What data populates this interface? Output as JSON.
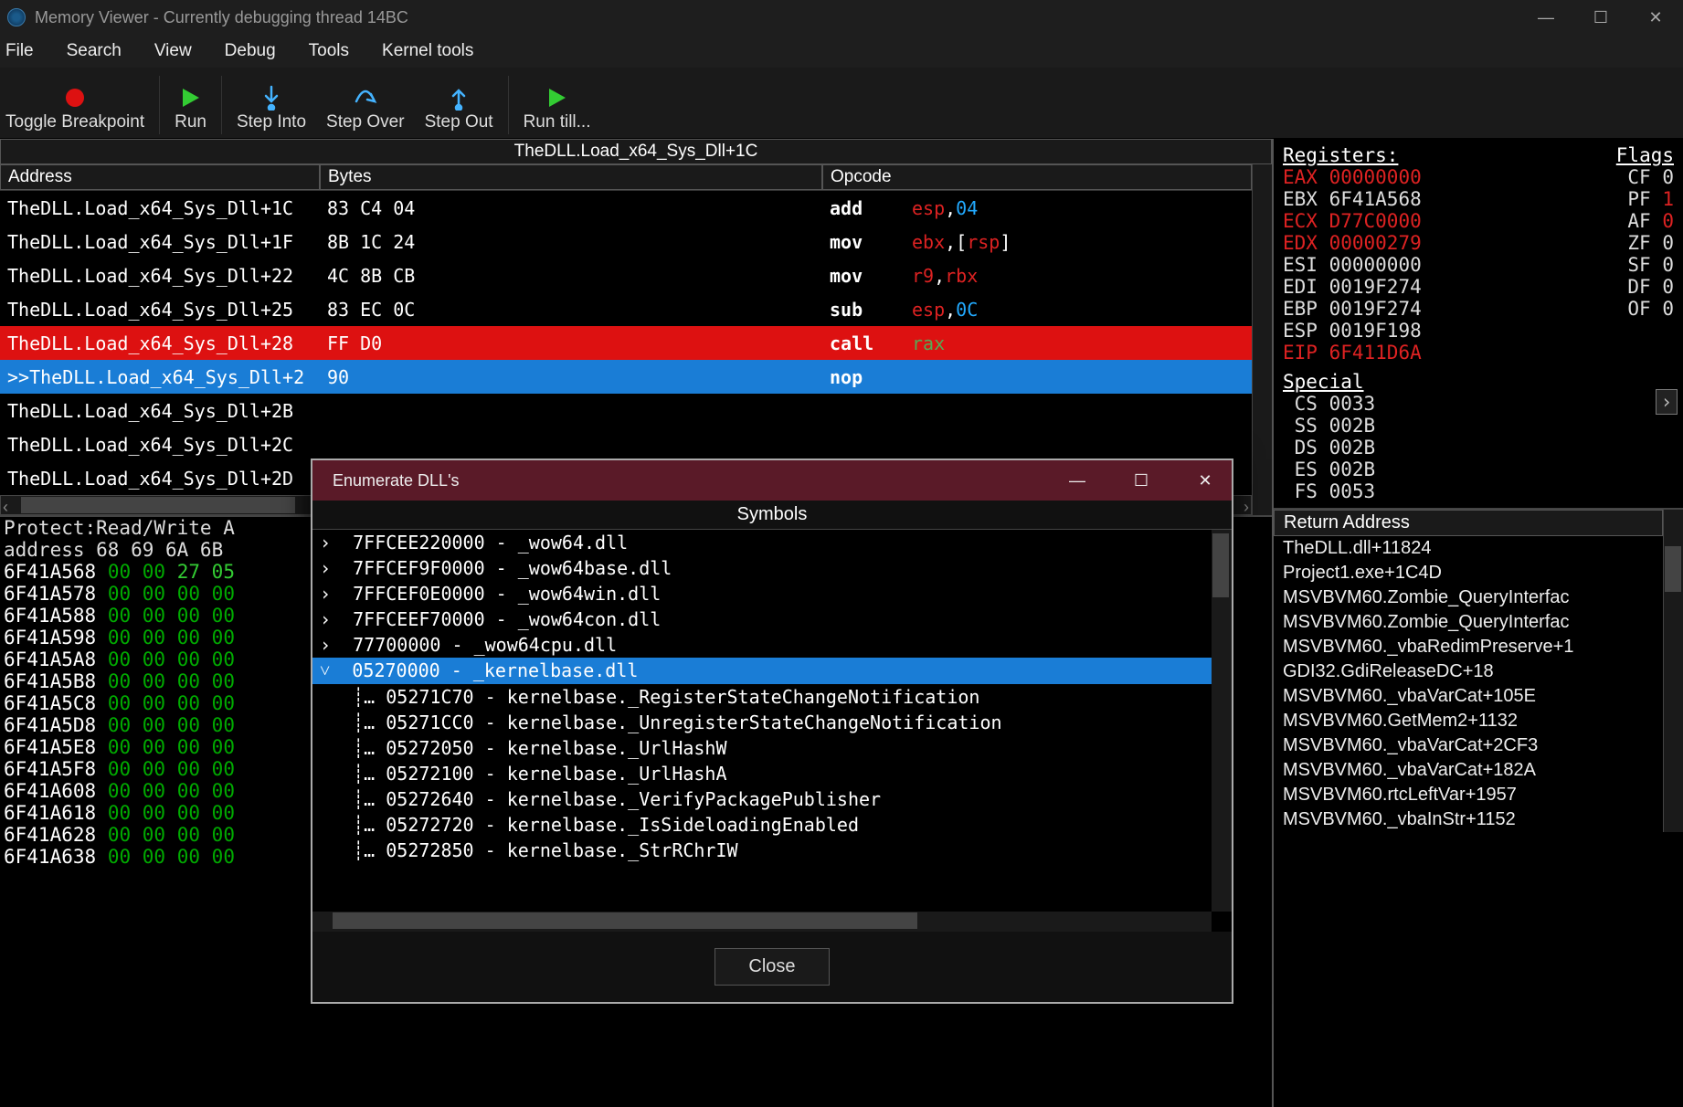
{
  "window": {
    "title": "Memory Viewer - Currently debugging thread 14BC"
  },
  "menu": [
    "File",
    "Search",
    "View",
    "Debug",
    "Tools",
    "Kernel tools"
  ],
  "toolbar": {
    "toggle_bp": "Toggle Breakpoint",
    "run": "Run",
    "step_into": "Step Into",
    "step_over": "Step Over",
    "step_out": "Step Out",
    "run_till": "Run till..."
  },
  "disasm": {
    "title": "TheDLL.Load_x64_Sys_Dll+1C",
    "headers": {
      "addr": "Address",
      "bytes": "Bytes",
      "opcode": "Opcode"
    },
    "rows": [
      {
        "addr": "TheDLL.Load_x64_Sys_Dll+1C",
        "bytes": "83 C4 04",
        "mnem": "add",
        "args": [
          [
            "reg",
            "esp"
          ],
          [
            "txt",
            ","
          ],
          [
            "imm",
            "04"
          ]
        ]
      },
      {
        "addr": "TheDLL.Load_x64_Sys_Dll+1F",
        "bytes": "8B 1C 24",
        "mnem": "mov",
        "args": [
          [
            "reg",
            "ebx"
          ],
          [
            "txt",
            ",["
          ],
          [
            "reg",
            "rsp"
          ],
          [
            "txt",
            "]"
          ]
        ]
      },
      {
        "addr": "TheDLL.Load_x64_Sys_Dll+22",
        "bytes": "4C 8B CB",
        "mnem": "mov",
        "args": [
          [
            "reg",
            "r9"
          ],
          [
            "txt",
            ","
          ],
          [
            "reg",
            "rbx"
          ]
        ]
      },
      {
        "addr": "TheDLL.Load_x64_Sys_Dll+25",
        "bytes": "83 EC 0C",
        "mnem": "sub",
        "args": [
          [
            "reg",
            "esp"
          ],
          [
            "txt",
            ","
          ],
          [
            "imm",
            "0C"
          ]
        ]
      },
      {
        "addr": "TheDLL.Load_x64_Sys_Dll+28",
        "bytes": "FF D0",
        "mnem": "call",
        "args": [
          [
            "rax",
            "rax"
          ]
        ],
        "cls": "red"
      },
      {
        "addr": ">>TheDLL.Load_x64_Sys_Dll+2",
        "bytes": "90",
        "mnem": "nop",
        "args": [],
        "cls": "blue"
      },
      {
        "addr": "TheDLL.Load_x64_Sys_Dll+2B",
        "bytes": "",
        "mnem": "",
        "args": []
      },
      {
        "addr": "TheDLL.Load_x64_Sys_Dll+2C",
        "bytes": "",
        "mnem": "",
        "args": []
      },
      {
        "addr": "TheDLL.Load_x64_Sys_Dll+2D",
        "bytes": "",
        "mnem": "",
        "args": []
      }
    ]
  },
  "registers": {
    "title": "Registers:",
    "flags_title": "Flags",
    "lines": [
      {
        "reg": "EAX",
        "val": "00000000",
        "reg_cls": "red",
        "val_cls": "red",
        "flag": "CF",
        "fv": "0"
      },
      {
        "reg": "EBX",
        "val": "6F41A568",
        "flag": "PF",
        "fv": "1",
        "fcls": "red"
      },
      {
        "reg": "ECX",
        "val": "D77C0000",
        "reg_cls": "red",
        "val_cls": "red",
        "flag": "AF",
        "fv": "0",
        "fcls": "red"
      },
      {
        "reg": "EDX",
        "val": "00000279",
        "reg_cls": "red",
        "val_cls": "red",
        "flag": "ZF",
        "fv": "0"
      },
      {
        "reg": "ESI",
        "val": "00000000",
        "flag": "SF",
        "fv": "0"
      },
      {
        "reg": "EDI",
        "val": "0019F274",
        "flag": "DF",
        "fv": "0"
      },
      {
        "reg": "EBP",
        "val": "0019F274",
        "flag": "OF",
        "fv": "0"
      },
      {
        "reg": "ESP",
        "val": "0019F198"
      },
      {
        "reg": "EIP",
        "val": "6F411D6A",
        "reg_cls": "red",
        "val_cls": "red"
      }
    ],
    "special_title": "Special",
    "special": [
      {
        "reg": "CS",
        "val": "0033"
      },
      {
        "reg": "SS",
        "val": "002B"
      },
      {
        "reg": "DS",
        "val": "002B"
      },
      {
        "reg": "ES",
        "val": "002B"
      },
      {
        "reg": "FS",
        "val": "0053"
      }
    ]
  },
  "hex": {
    "header1": "Protect:Read/Write  A",
    "header2": "address  68 69 6A 6B",
    "rows": [
      {
        "addr": "6F41A568",
        "b": [
          "00",
          "00",
          "27",
          "05"
        ]
      },
      {
        "addr": "6F41A578",
        "b": [
          "00",
          "00",
          "00",
          "00"
        ]
      },
      {
        "addr": "6F41A588",
        "b": [
          "00",
          "00",
          "00",
          "00"
        ]
      },
      {
        "addr": "6F41A598",
        "b": [
          "00",
          "00",
          "00",
          "00"
        ]
      },
      {
        "addr": "6F41A5A8",
        "b": [
          "00",
          "00",
          "00",
          "00"
        ]
      },
      {
        "addr": "6F41A5B8",
        "b": [
          "00",
          "00",
          "00",
          "00"
        ]
      },
      {
        "addr": "6F41A5C8",
        "b": [
          "00",
          "00",
          "00",
          "00"
        ]
      },
      {
        "addr": "6F41A5D8",
        "b": [
          "00",
          "00",
          "00",
          "00"
        ]
      },
      {
        "addr": "6F41A5E8",
        "b": [
          "00",
          "00",
          "00",
          "00"
        ]
      },
      {
        "addr": "6F41A5F8",
        "b": [
          "00",
          "00",
          "00",
          "00"
        ]
      },
      {
        "addr": "6F41A608",
        "b": [
          "00",
          "00",
          "00",
          "00"
        ]
      },
      {
        "addr": "6F41A618",
        "b": [
          "00",
          "00",
          "00",
          "00"
        ]
      },
      {
        "addr": "6F41A628",
        "b": [
          "00",
          "00",
          "00",
          "00"
        ]
      },
      {
        "addr": "6F41A638",
        "b": [
          "00",
          "00",
          "00",
          "00"
        ]
      }
    ]
  },
  "stack": {
    "header": "Return Address",
    "rows": [
      "TheDLL.dll+11824",
      "Project1.exe+1C4D",
      "MSVBVM60.Zombie_QueryInterfac",
      "MSVBVM60.Zombie_QueryInterfac",
      "MSVBVM60._vbaRedimPreserve+1",
      "GDI32.GdiReleaseDC+18",
      "MSVBVM60._vbaVarCat+105E",
      "MSVBVM60.GetMem2+1132",
      "MSVBVM60._vbaVarCat+2CF3",
      "MSVBVM60._vbaVarCat+182A",
      "MSVBVM60.rtcLeftVar+1957",
      "MSVBVM60._vbaInStr+1152"
    ]
  },
  "dialog": {
    "title": "Enumerate DLL's",
    "subtitle": "Symbols",
    "close_btn": "Close",
    "rows": [
      {
        "indent": 0,
        "arrow": "›",
        "text": "7FFCEE220000 - _wow64.dll"
      },
      {
        "indent": 0,
        "arrow": "›",
        "text": "7FFCEF9F0000 - _wow64base.dll"
      },
      {
        "indent": 0,
        "arrow": "›",
        "text": "7FFCEF0E0000 - _wow64win.dll"
      },
      {
        "indent": 0,
        "arrow": "›",
        "text": "7FFCEEF70000 - _wow64con.dll"
      },
      {
        "indent": 0,
        "arrow": "›",
        "text": "77700000 - _wow64cpu.dll"
      },
      {
        "indent": 0,
        "arrow": "˅",
        "text": "05270000 - _kernelbase.dll",
        "sel": true
      },
      {
        "indent": 1,
        "text": "05271C70 - kernelbase._RegisterStateChangeNotification"
      },
      {
        "indent": 1,
        "text": "05271CC0 - kernelbase._UnregisterStateChangeNotification"
      },
      {
        "indent": 1,
        "text": "05272050 - kernelbase._UrlHashW"
      },
      {
        "indent": 1,
        "text": "05272100 - kernelbase._UrlHashA"
      },
      {
        "indent": 1,
        "text": "05272640 - kernelbase._VerifyPackagePublisher"
      },
      {
        "indent": 1,
        "text": "05272720 - kernelbase._IsSideloadingEnabled"
      },
      {
        "indent": 1,
        "text": "05272850 - kernelbase._StrRChrIW"
      }
    ]
  }
}
